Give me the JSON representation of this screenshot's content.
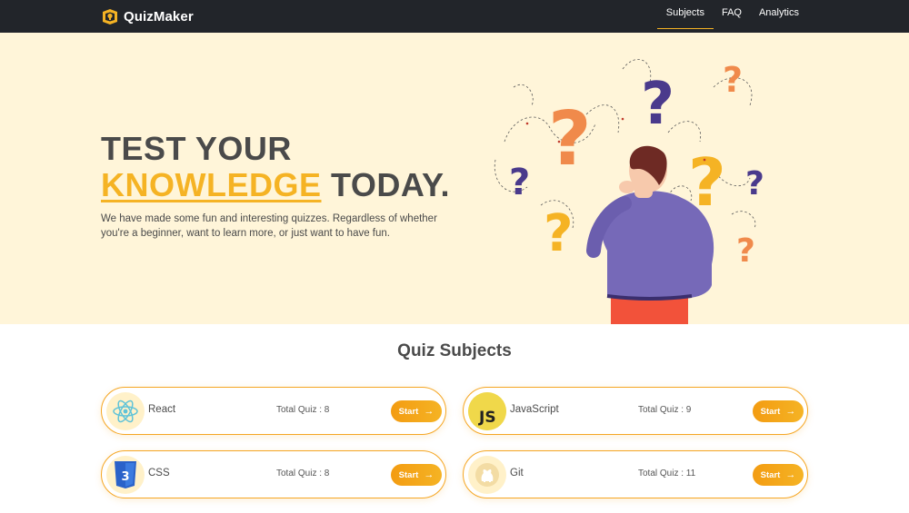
{
  "brand": {
    "name": "QuizMaker",
    "icon": "quizmaker-logo-icon"
  },
  "nav": {
    "items": [
      {
        "label": "Subjects",
        "active": true
      },
      {
        "label": "FAQ",
        "active": false
      },
      {
        "label": "Analytics",
        "active": false
      }
    ]
  },
  "hero": {
    "title_line1": "TEST YOUR",
    "title_highlight": "KNOWLEDGE",
    "title_rest": " TODAY.",
    "description": "We have made some fun and interesting quizzes. Regardless of whether you're a beginner, want to learn more, or just want to have fun.",
    "illustration": "person-with-question-marks"
  },
  "subjects": {
    "title": "Quiz Subjects",
    "items": [
      {
        "name": "React",
        "total": "Total Quiz : 8",
        "start": "Start",
        "icon": "react-icon"
      },
      {
        "name": "JavaScript",
        "total": "Total Quiz : 9",
        "start": "Start",
        "icon": "javascript-icon"
      },
      {
        "name": "CSS",
        "total": "Total Quiz : 8",
        "start": "Start",
        "icon": "css3-icon"
      },
      {
        "name": "Git",
        "total": "Total Quiz : 11",
        "start": "Start",
        "icon": "git-icon"
      }
    ]
  },
  "colors": {
    "accent": "#f5b324",
    "orange": "#f39c12",
    "navbar": "#22252a",
    "hero_bg": "#fff5d9",
    "purple": "#5b3f9e"
  }
}
